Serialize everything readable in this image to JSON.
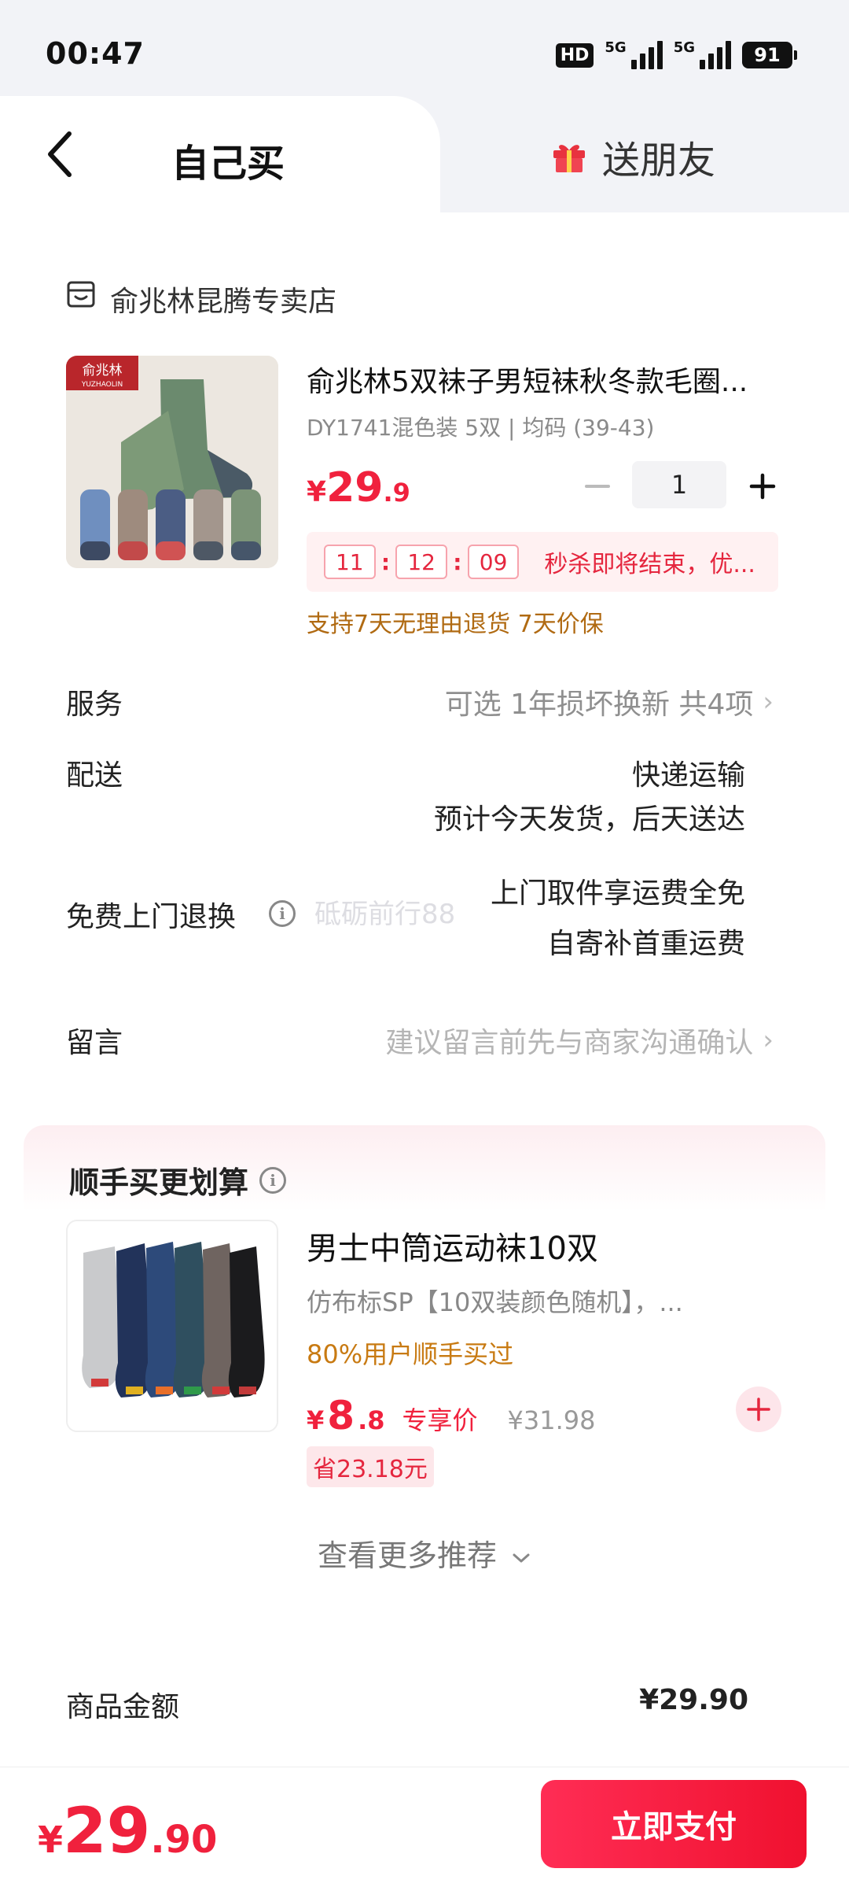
{
  "status_bar": {
    "time": "00:47",
    "network_badge": "HD",
    "network_1": "5G",
    "network_2": "5G",
    "battery": "91"
  },
  "header": {
    "tab_self": "自己买",
    "tab_gift": "送朋友",
    "icons": {
      "back": "chevron-left-icon",
      "gift": "gift-icon"
    }
  },
  "store": {
    "name": "俞兆林昆腾专卖店",
    "icon": "store-icon"
  },
  "product": {
    "title": "俞兆林5双袜子男短袜秋冬款毛圈...",
    "spec": "DY1741混色装 5双 | 均码 (39-43)",
    "price_currency": "¥",
    "price_int": "29",
    "price_dec": ".9",
    "quantity": "1",
    "image_brand": "俞兆林",
    "image_brand_sub": "YUZHAOLIN",
    "countdown": {
      "hours": "11",
      "minutes": "12",
      "seconds": "09"
    },
    "flash_text": "秒杀即将结束，优...",
    "guarantee": "支持7天无理由退货  7天价保"
  },
  "rows": {
    "service_label": "服务",
    "service_value": "可选 1年损坏换新 共4项",
    "delivery_label": "配送",
    "delivery_value_1": "快递运输",
    "delivery_value_2": "预计今天发货，后天送达",
    "return_label": "免费上门退换",
    "return_value_1": "上门取件享运费全免",
    "return_value_2": "自寄补首重运费",
    "message_label": "留言",
    "message_placeholder": "建议留言前先与商家沟通确认"
  },
  "watermark": "砥砺前行88",
  "upsell": {
    "title": "顺手买更划算",
    "name": "男士中筒运动袜10双",
    "desc": "仿布标SP【10双装颜色随机】，...",
    "hot": "80%用户顺手买过",
    "price_currency": "¥",
    "price_int": "8",
    "price_dec": ".8",
    "price_tag": "专享价",
    "orig_price": "¥31.98",
    "save": "省23.18元",
    "more": "查看更多推荐"
  },
  "summary": {
    "goods_label": "商品金额",
    "goods_value": "¥29.90"
  },
  "bottom": {
    "currency": "¥",
    "total_int": "29",
    "total_dec": ".90",
    "pay_label": "立即支付"
  },
  "colors": {
    "accent_red": "#f0213d",
    "guarantee_brown": "#b06a12",
    "muted_gray": "#a0a0a0"
  }
}
